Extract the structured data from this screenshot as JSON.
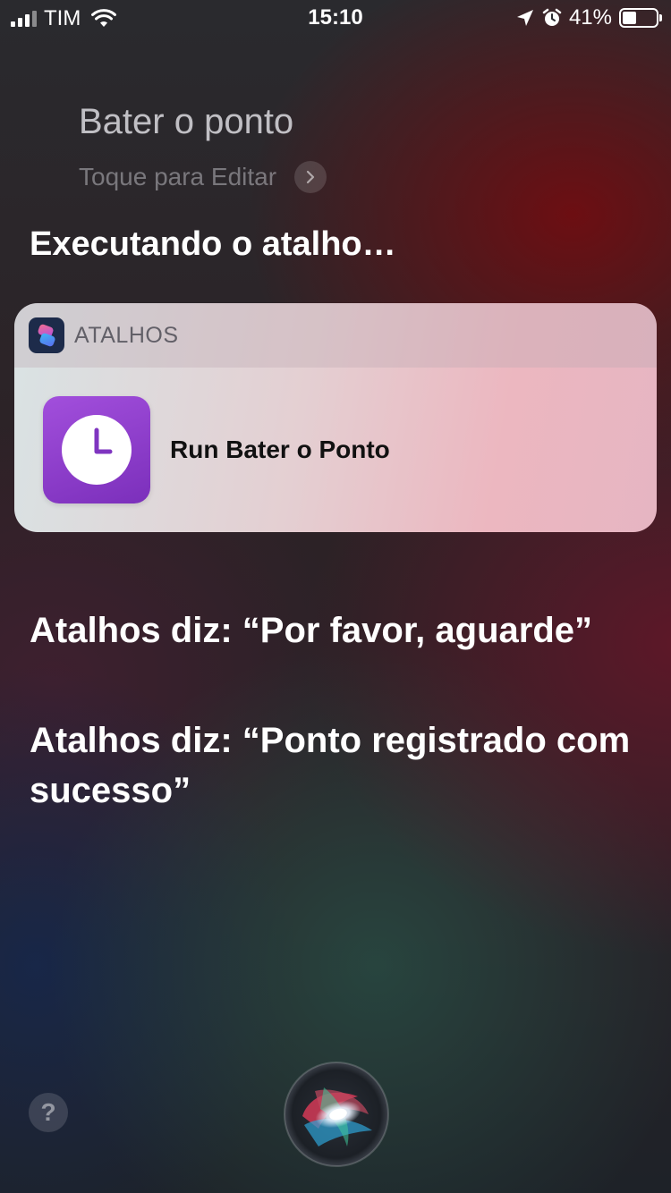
{
  "status_bar": {
    "carrier": "TIM",
    "time": "15:10",
    "battery_percent": "41%",
    "battery_level": 0.41,
    "signal_bars": 3,
    "icons": [
      "signal-icon",
      "wifi-icon",
      "location-arrow-icon",
      "alarm-icon",
      "battery-icon"
    ]
  },
  "siri": {
    "query": "Bater o ponto",
    "edit_hint": "Toque para Editar",
    "running_title": "Executando o atalho…"
  },
  "card": {
    "app_name": "ATALHOS",
    "app_icon": "shortcuts-app-icon",
    "shortcut_icon": "clock-icon",
    "shortcut_label": "Run Bater o Ponto",
    "shortcut_color": "#8e3fcf"
  },
  "responses": [
    " Atalhos diz: “Por favor, aguarde”",
    " Atalhos diz: “Ponto registrado com sucesso”"
  ],
  "bottom": {
    "help_label": "?",
    "siri_icon": "siri-orb-icon"
  }
}
